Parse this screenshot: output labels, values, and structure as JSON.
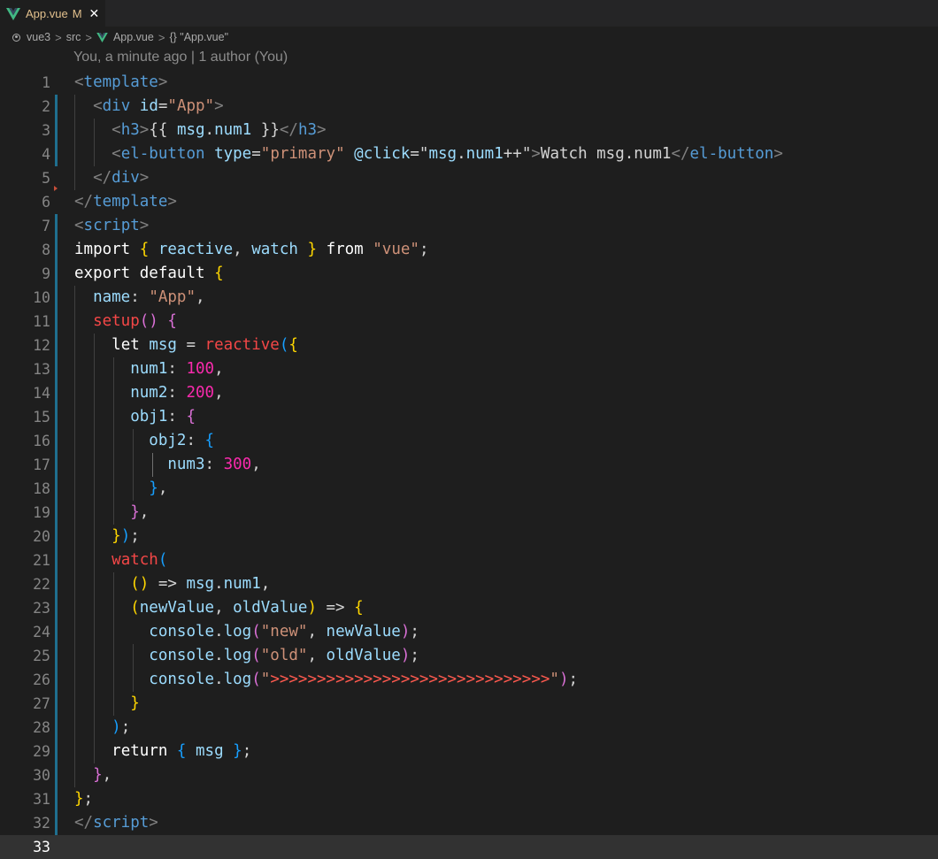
{
  "tab": {
    "title": "App.vue",
    "modified": "M",
    "close": "✕"
  },
  "breadcrumb": [
    "vue3",
    "src",
    "App.vue",
    "{} \"App.vue\""
  ],
  "codelens": "You, a minute ago | 1 author (You)",
  "colors": {
    "background": "#1e1e1e",
    "tab_text": "#e2c08d",
    "vue_green": "#41b883",
    "gutter_bar": "#1f6f8f"
  },
  "lines": [
    {
      "n": "1",
      "tokens": [
        [
          "t-punc",
          "<"
        ],
        [
          "t-tag",
          "template"
        ],
        [
          "t-punc",
          ">"
        ]
      ]
    },
    {
      "n": "2",
      "tokens": [
        [
          "t-txt",
          "  "
        ],
        [
          "t-punc",
          "<"
        ],
        [
          "t-tag",
          "div"
        ],
        [
          "t-txt",
          " "
        ],
        [
          "t-attr",
          "id"
        ],
        [
          "t-txt",
          "="
        ],
        [
          "t-str",
          "\"App\""
        ],
        [
          "t-punc",
          ">"
        ]
      ]
    },
    {
      "n": "3",
      "tokens": [
        [
          "t-txt",
          "    "
        ],
        [
          "t-punc",
          "<"
        ],
        [
          "t-tag",
          "h3"
        ],
        [
          "t-punc",
          ">"
        ],
        [
          "t-txt",
          "{{ "
        ],
        [
          "t-var",
          "msg"
        ],
        [
          "t-txt",
          "."
        ],
        [
          "t-var",
          "num1"
        ],
        [
          "t-txt",
          " }}"
        ],
        [
          "t-punc",
          "</"
        ],
        [
          "t-tag",
          "h3"
        ],
        [
          "t-punc",
          ">"
        ]
      ]
    },
    {
      "n": "4",
      "tokens": [
        [
          "t-txt",
          "    "
        ],
        [
          "t-punc",
          "<"
        ],
        [
          "t-tag",
          "el-button"
        ],
        [
          "t-txt",
          " "
        ],
        [
          "t-attr",
          "type"
        ],
        [
          "t-txt",
          "="
        ],
        [
          "t-str",
          "\"primary\""
        ],
        [
          "t-txt",
          " "
        ],
        [
          "t-attr",
          "@click"
        ],
        [
          "t-txt",
          "=\""
        ],
        [
          "t-var",
          "msg"
        ],
        [
          "t-txt",
          "."
        ],
        [
          "t-var",
          "num1"
        ],
        [
          "t-txt",
          "++\""
        ],
        [
          "t-punc",
          ">"
        ],
        [
          "t-txt",
          "Watch msg.num1"
        ],
        [
          "t-punc",
          "</"
        ],
        [
          "t-tag",
          "el-button"
        ],
        [
          "t-punc",
          ">"
        ]
      ]
    },
    {
      "n": "5",
      "tokens": [
        [
          "t-txt",
          "  "
        ],
        [
          "t-punc",
          "</"
        ],
        [
          "t-tag",
          "div"
        ],
        [
          "t-punc",
          ">"
        ]
      ]
    },
    {
      "n": "6",
      "tokens": [
        [
          "t-punc",
          "</"
        ],
        [
          "t-tag",
          "template"
        ],
        [
          "t-punc",
          ">"
        ]
      ]
    },
    {
      "n": "7",
      "tokens": [
        [
          "t-punc",
          "<"
        ],
        [
          "t-tag",
          "script"
        ],
        [
          "t-punc",
          ">"
        ]
      ]
    },
    {
      "n": "8",
      "tokens": [
        [
          "t-kw",
          "import"
        ],
        [
          "t-txt",
          " "
        ],
        [
          "t-b1",
          "{"
        ],
        [
          "t-txt",
          " "
        ],
        [
          "t-var",
          "reactive"
        ],
        [
          "t-txt",
          ", "
        ],
        [
          "t-var",
          "watch"
        ],
        [
          "t-txt",
          " "
        ],
        [
          "t-b1",
          "}"
        ],
        [
          "t-txt",
          " "
        ],
        [
          "t-kw",
          "from"
        ],
        [
          "t-txt",
          " "
        ],
        [
          "t-str",
          "\"vue\""
        ],
        [
          "t-txt",
          ";"
        ]
      ]
    },
    {
      "n": "9",
      "tokens": [
        [
          "t-kw",
          "export"
        ],
        [
          "t-txt",
          " "
        ],
        [
          "t-kw",
          "default"
        ],
        [
          "t-txt",
          " "
        ],
        [
          "t-b1",
          "{"
        ]
      ]
    },
    {
      "n": "10",
      "tokens": [
        [
          "t-txt",
          "  "
        ],
        [
          "t-key",
          "name"
        ],
        [
          "t-txt",
          ": "
        ],
        [
          "t-str",
          "\"App\""
        ],
        [
          "t-txt",
          ","
        ]
      ]
    },
    {
      "n": "11",
      "tokens": [
        [
          "t-txt",
          "  "
        ],
        [
          "t-fn",
          "setup"
        ],
        [
          "t-b2",
          "()"
        ],
        [
          "t-txt",
          " "
        ],
        [
          "t-b2",
          "{"
        ]
      ]
    },
    {
      "n": "12",
      "tokens": [
        [
          "t-txt",
          "    "
        ],
        [
          "t-kw",
          "let"
        ],
        [
          "t-txt",
          " "
        ],
        [
          "t-var",
          "msg"
        ],
        [
          "t-txt",
          " = "
        ],
        [
          "t-fn",
          "reactive"
        ],
        [
          "t-b3",
          "("
        ],
        [
          "t-b1",
          "{"
        ]
      ]
    },
    {
      "n": "13",
      "tokens": [
        [
          "t-txt",
          "      "
        ],
        [
          "t-key",
          "num1"
        ],
        [
          "t-txt",
          ": "
        ],
        [
          "t-num",
          "100"
        ],
        [
          "t-txt",
          ","
        ]
      ]
    },
    {
      "n": "14",
      "tokens": [
        [
          "t-txt",
          "      "
        ],
        [
          "t-key",
          "num2"
        ],
        [
          "t-txt",
          ": "
        ],
        [
          "t-num",
          "200"
        ],
        [
          "t-txt",
          ","
        ]
      ]
    },
    {
      "n": "15",
      "tokens": [
        [
          "t-txt",
          "      "
        ],
        [
          "t-key",
          "obj1"
        ],
        [
          "t-txt",
          ": "
        ],
        [
          "t-b2",
          "{"
        ]
      ]
    },
    {
      "n": "16",
      "tokens": [
        [
          "t-txt",
          "        "
        ],
        [
          "t-key",
          "obj2"
        ],
        [
          "t-txt",
          ": "
        ],
        [
          "t-b3",
          "{"
        ]
      ]
    },
    {
      "n": "17",
      "tokens": [
        [
          "t-txt",
          "          "
        ],
        [
          "t-key",
          "num3"
        ],
        [
          "t-txt",
          ": "
        ],
        [
          "t-num",
          "300"
        ],
        [
          "t-txt",
          ","
        ]
      ]
    },
    {
      "n": "18",
      "tokens": [
        [
          "t-txt",
          "        "
        ],
        [
          "t-b3",
          "}"
        ],
        [
          "t-txt",
          ","
        ]
      ]
    },
    {
      "n": "19",
      "tokens": [
        [
          "t-txt",
          "      "
        ],
        [
          "t-b2",
          "}"
        ],
        [
          "t-txt",
          ","
        ]
      ]
    },
    {
      "n": "20",
      "tokens": [
        [
          "t-txt",
          "    "
        ],
        [
          "t-b1",
          "}"
        ],
        [
          "t-b3",
          ")"
        ],
        [
          "t-txt",
          ";"
        ]
      ]
    },
    {
      "n": "21",
      "tokens": [
        [
          "t-txt",
          "    "
        ],
        [
          "t-fn",
          "watch"
        ],
        [
          "t-b3",
          "("
        ]
      ]
    },
    {
      "n": "22",
      "tokens": [
        [
          "t-txt",
          "      "
        ],
        [
          "t-b1",
          "()"
        ],
        [
          "t-txt",
          " => "
        ],
        [
          "t-var",
          "msg"
        ],
        [
          "t-txt",
          "."
        ],
        [
          "t-var",
          "num1"
        ],
        [
          "t-txt",
          ","
        ]
      ]
    },
    {
      "n": "23",
      "tokens": [
        [
          "t-txt",
          "      "
        ],
        [
          "t-b1",
          "("
        ],
        [
          "t-var",
          "newValue"
        ],
        [
          "t-txt",
          ", "
        ],
        [
          "t-var",
          "oldValue"
        ],
        [
          "t-b1",
          ")"
        ],
        [
          "t-txt",
          " => "
        ],
        [
          "t-b1",
          "{"
        ]
      ]
    },
    {
      "n": "24",
      "tokens": [
        [
          "t-txt",
          "        "
        ],
        [
          "t-var",
          "console"
        ],
        [
          "t-txt",
          "."
        ],
        [
          "t-var",
          "log"
        ],
        [
          "t-b2",
          "("
        ],
        [
          "t-str",
          "\"new\""
        ],
        [
          "t-txt",
          ", "
        ],
        [
          "t-var",
          "newValue"
        ],
        [
          "t-b2",
          ")"
        ],
        [
          "t-txt",
          ";"
        ]
      ]
    },
    {
      "n": "25",
      "tokens": [
        [
          "t-txt",
          "        "
        ],
        [
          "t-var",
          "console"
        ],
        [
          "t-txt",
          "."
        ],
        [
          "t-var",
          "log"
        ],
        [
          "t-b2",
          "("
        ],
        [
          "t-str",
          "\"old\""
        ],
        [
          "t-txt",
          ", "
        ],
        [
          "t-var",
          "oldValue"
        ],
        [
          "t-b2",
          ")"
        ],
        [
          "t-txt",
          ";"
        ]
      ]
    },
    {
      "n": "26",
      "tokens": [
        [
          "t-txt",
          "        "
        ],
        [
          "t-var",
          "console"
        ],
        [
          "t-txt",
          "."
        ],
        [
          "t-var",
          "log"
        ],
        [
          "t-b2",
          "("
        ],
        [
          "t-str",
          "\""
        ],
        [
          "t-str2",
          ">>>>>>>>>>>>>>>>>>>>>>>>>>>>>>"
        ],
        [
          "t-str",
          "\""
        ],
        [
          "t-b2",
          ")"
        ],
        [
          "t-txt",
          ";"
        ]
      ]
    },
    {
      "n": "27",
      "tokens": [
        [
          "t-txt",
          "      "
        ],
        [
          "t-b1",
          "}"
        ]
      ]
    },
    {
      "n": "28",
      "tokens": [
        [
          "t-txt",
          "    "
        ],
        [
          "t-b3",
          ")"
        ],
        [
          "t-txt",
          ";"
        ]
      ]
    },
    {
      "n": "29",
      "tokens": [
        [
          "t-txt",
          "    "
        ],
        [
          "t-kw",
          "return"
        ],
        [
          "t-txt",
          " "
        ],
        [
          "t-b3",
          "{"
        ],
        [
          "t-txt",
          " "
        ],
        [
          "t-var",
          "msg"
        ],
        [
          "t-txt",
          " "
        ],
        [
          "t-b3",
          "}"
        ],
        [
          "t-txt",
          ";"
        ]
      ]
    },
    {
      "n": "30",
      "tokens": [
        [
          "t-txt",
          "  "
        ],
        [
          "t-b2",
          "}"
        ],
        [
          "t-txt",
          ","
        ]
      ]
    },
    {
      "n": "31",
      "tokens": [
        [
          "t-b1",
          "}"
        ],
        [
          "t-txt",
          ";"
        ]
      ]
    },
    {
      "n": "32",
      "tokens": [
        [
          "t-punc",
          "</"
        ],
        [
          "t-tag",
          "script"
        ],
        [
          "t-punc",
          ">"
        ]
      ]
    },
    {
      "n": "33",
      "tokens": []
    }
  ]
}
